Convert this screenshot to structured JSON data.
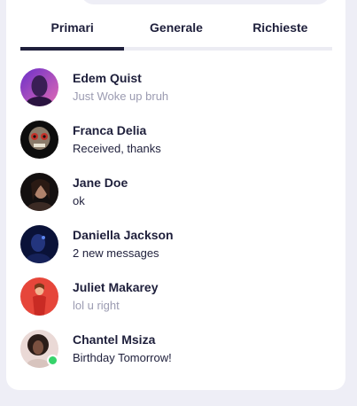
{
  "tabs": [
    {
      "label": "Primari",
      "active": true
    },
    {
      "label": "Generale",
      "active": false
    },
    {
      "label": "Richieste",
      "active": false
    }
  ],
  "conversations": [
    {
      "name": "Edem Quist",
      "message": "Just Woke up bruh",
      "read": true,
      "avatar_colors": [
        "#7b3fd6",
        "#e06fb8"
      ]
    },
    {
      "name": "Franca Delia",
      "message": "Received, thanks",
      "read": false,
      "avatar_colors": [
        "#0d0d0d",
        "#c53a2f"
      ]
    },
    {
      "name": "Jane Doe",
      "message": "ok",
      "read": false,
      "avatar_colors": [
        "#1a1412",
        "#a97a63"
      ]
    },
    {
      "name": "Daniella Jackson",
      "message": "2 new messages",
      "read": false,
      "avatar_colors": [
        "#0b1540",
        "#3b5fd1"
      ]
    },
    {
      "name": "Juliet Makarey",
      "message": "lol u right",
      "read": true,
      "avatar_colors": [
        "#e8453a",
        "#ffc6a8"
      ]
    },
    {
      "name": "Chantel Msiza",
      "message": "Birthday Tomorrow!",
      "read": false,
      "online": true,
      "avatar_colors": [
        "#ead9d6",
        "#2a1c18"
      ]
    }
  ]
}
